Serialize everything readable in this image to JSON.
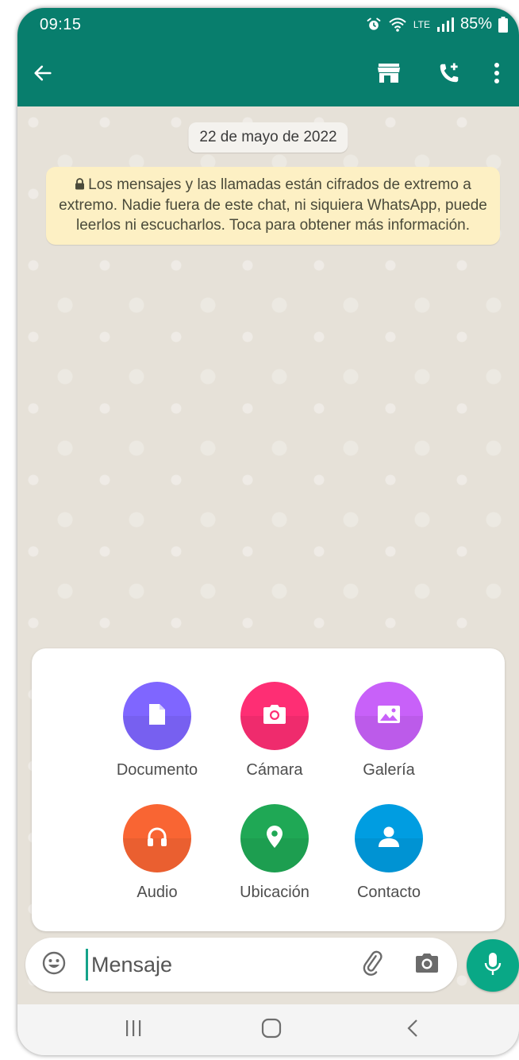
{
  "status_bar": {
    "time": "09:15",
    "network_label": "LTE",
    "battery": "85%"
  },
  "toolbar": {
    "back_icon": "arrow-left-icon",
    "store_icon": "store-icon",
    "add_call_icon": "phone-add-icon",
    "menu_icon": "more-vertical-icon"
  },
  "chat": {
    "date_chip": "22 de mayo de 2022",
    "encryption_notice": "Los mensajes y las llamadas están cifrados de extremo a extremo. Nadie fuera de este chat, ni siquiera WhatsApp, puede leerlos ni escucharlos. Toca para obtener más información."
  },
  "attach_panel": {
    "items": [
      {
        "label": "Documento",
        "icon": "document-icon",
        "color": "#7f66ff"
      },
      {
        "label": "Cámara",
        "icon": "camera-icon",
        "color": "#fe2e74"
      },
      {
        "label": "Galería",
        "icon": "gallery-icon",
        "color": "#c861f9"
      },
      {
        "label": "Audio",
        "icon": "headphones-icon",
        "color": "#f96533"
      },
      {
        "label": "Ubicación",
        "icon": "location-pin-icon",
        "color": "#1fa855"
      },
      {
        "label": "Contacto",
        "icon": "contact-icon",
        "color": "#009de1"
      }
    ]
  },
  "input": {
    "placeholder": "Mensaje",
    "value": ""
  },
  "colors": {
    "header": "#087e6d",
    "mic_button": "#09a886",
    "notice_bg": "#fdf0c4"
  }
}
